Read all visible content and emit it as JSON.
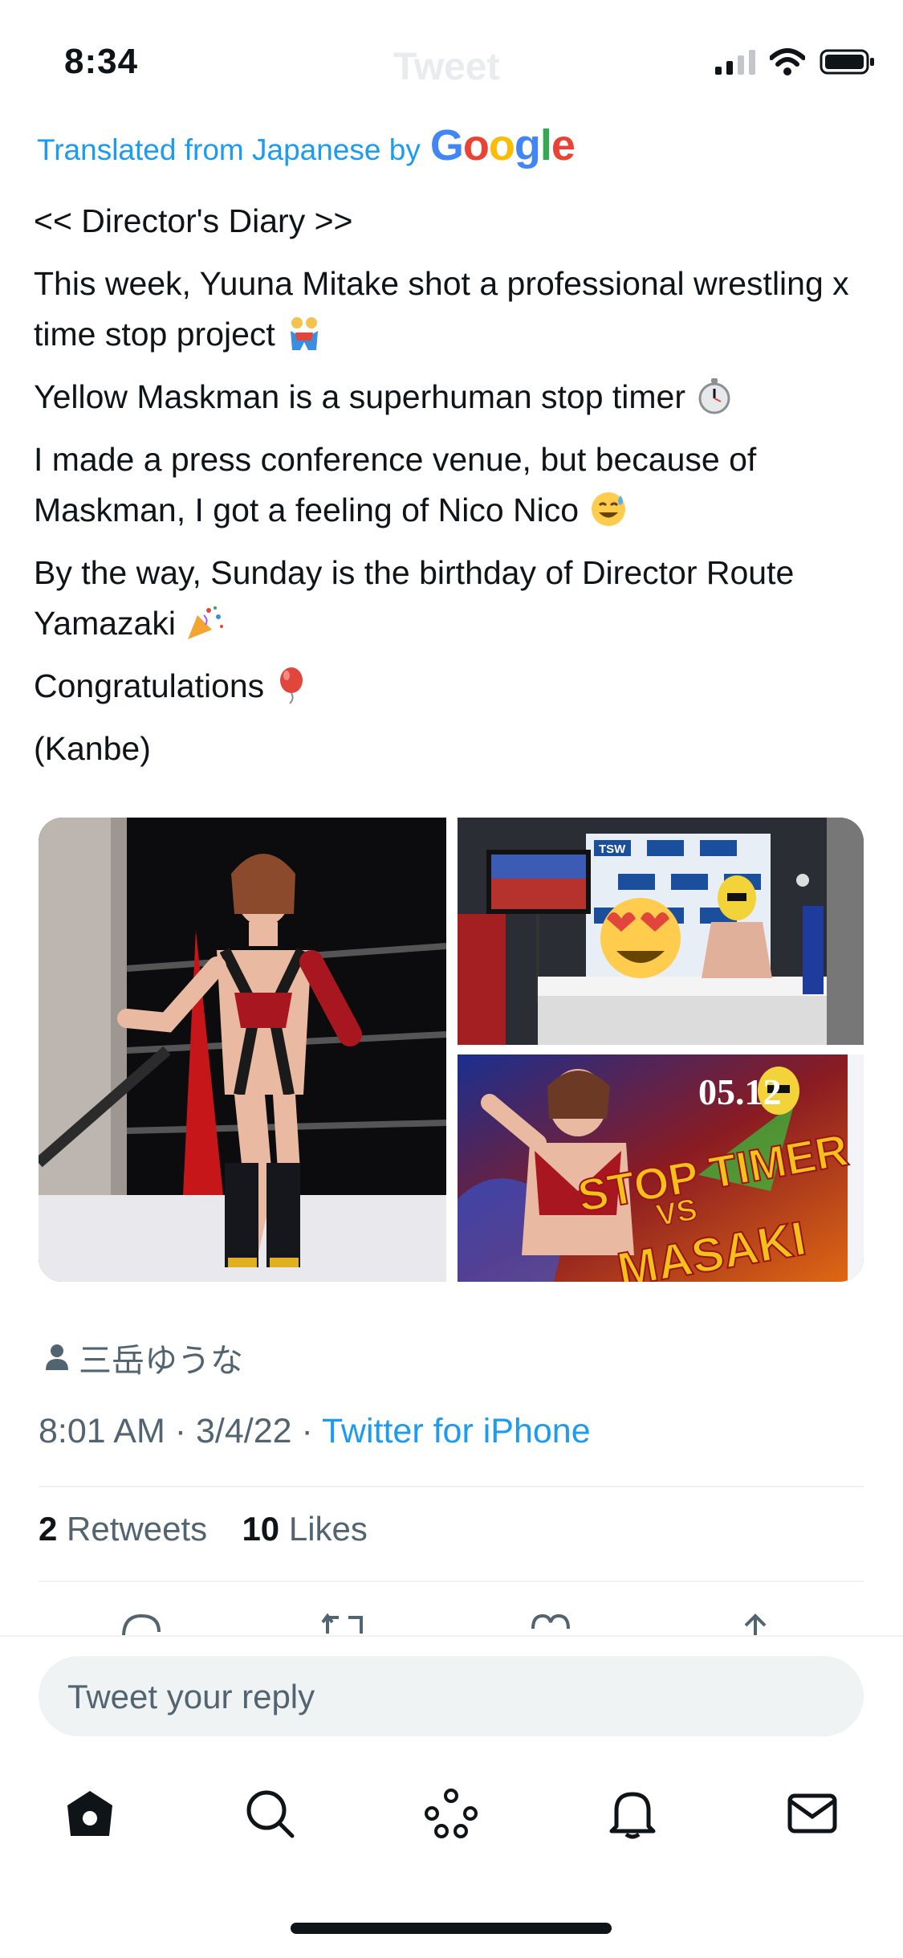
{
  "status_bar": {
    "time": "8:34",
    "ghost_title": "Tweet"
  },
  "translation": {
    "prefix": "Translated from Japanese by",
    "brand": "Google"
  },
  "tweet": {
    "paragraphs": [
      {
        "text": "<< Director's Diary >>",
        "emoji": null
      },
      {
        "text": " This week, Yuuna Mitake shot a professional wrestling x time stop project",
        "emoji": "wrestlers-emoji"
      },
      {
        "text": " Yellow Maskman is a superhuman stop timer",
        "emoji": "stopwatch-emoji"
      },
      {
        "text": " I made a press conference venue, but because of Maskman, I got a feeling of Nico Nico",
        "emoji": "sweat-smile-emoji"
      },
      {
        "text": " By the way, Sunday is the birthday of Director Route Yamazaki",
        "emoji": "party-popper-emoji"
      },
      {
        "text": " Congratulations",
        "emoji": "balloon-emoji"
      },
      {
        "text": " (Kanbe)",
        "emoji": null
      }
    ],
    "media": [
      {
        "name": "photo-wrestler-pose",
        "overlay_text": ""
      },
      {
        "name": "photo-press-conference",
        "overlay_text": "TSW"
      },
      {
        "name": "photo-stop-timer-poster",
        "overlay_text": "05.12"
      }
    ],
    "poster_title": "STOP TIMER",
    "poster_vs": "VS",
    "poster_name": "MASAKI",
    "author_name": "三岳ゆうな",
    "time": "8:01 AM",
    "date": "3/4/22",
    "source": "Twitter for iPhone",
    "retweets_count": "2",
    "retweets_label": "Retweets",
    "likes_count": "10",
    "likes_label": "Likes"
  },
  "reply": {
    "placeholder": "Tweet your reply"
  },
  "colors": {
    "accent": "#1d9bf0",
    "secondary_text": "#536471",
    "primary_text": "#0f1419"
  },
  "tab_bar": [
    "home-icon",
    "search-icon",
    "spaces-icon",
    "notifications-icon",
    "messages-icon"
  ]
}
